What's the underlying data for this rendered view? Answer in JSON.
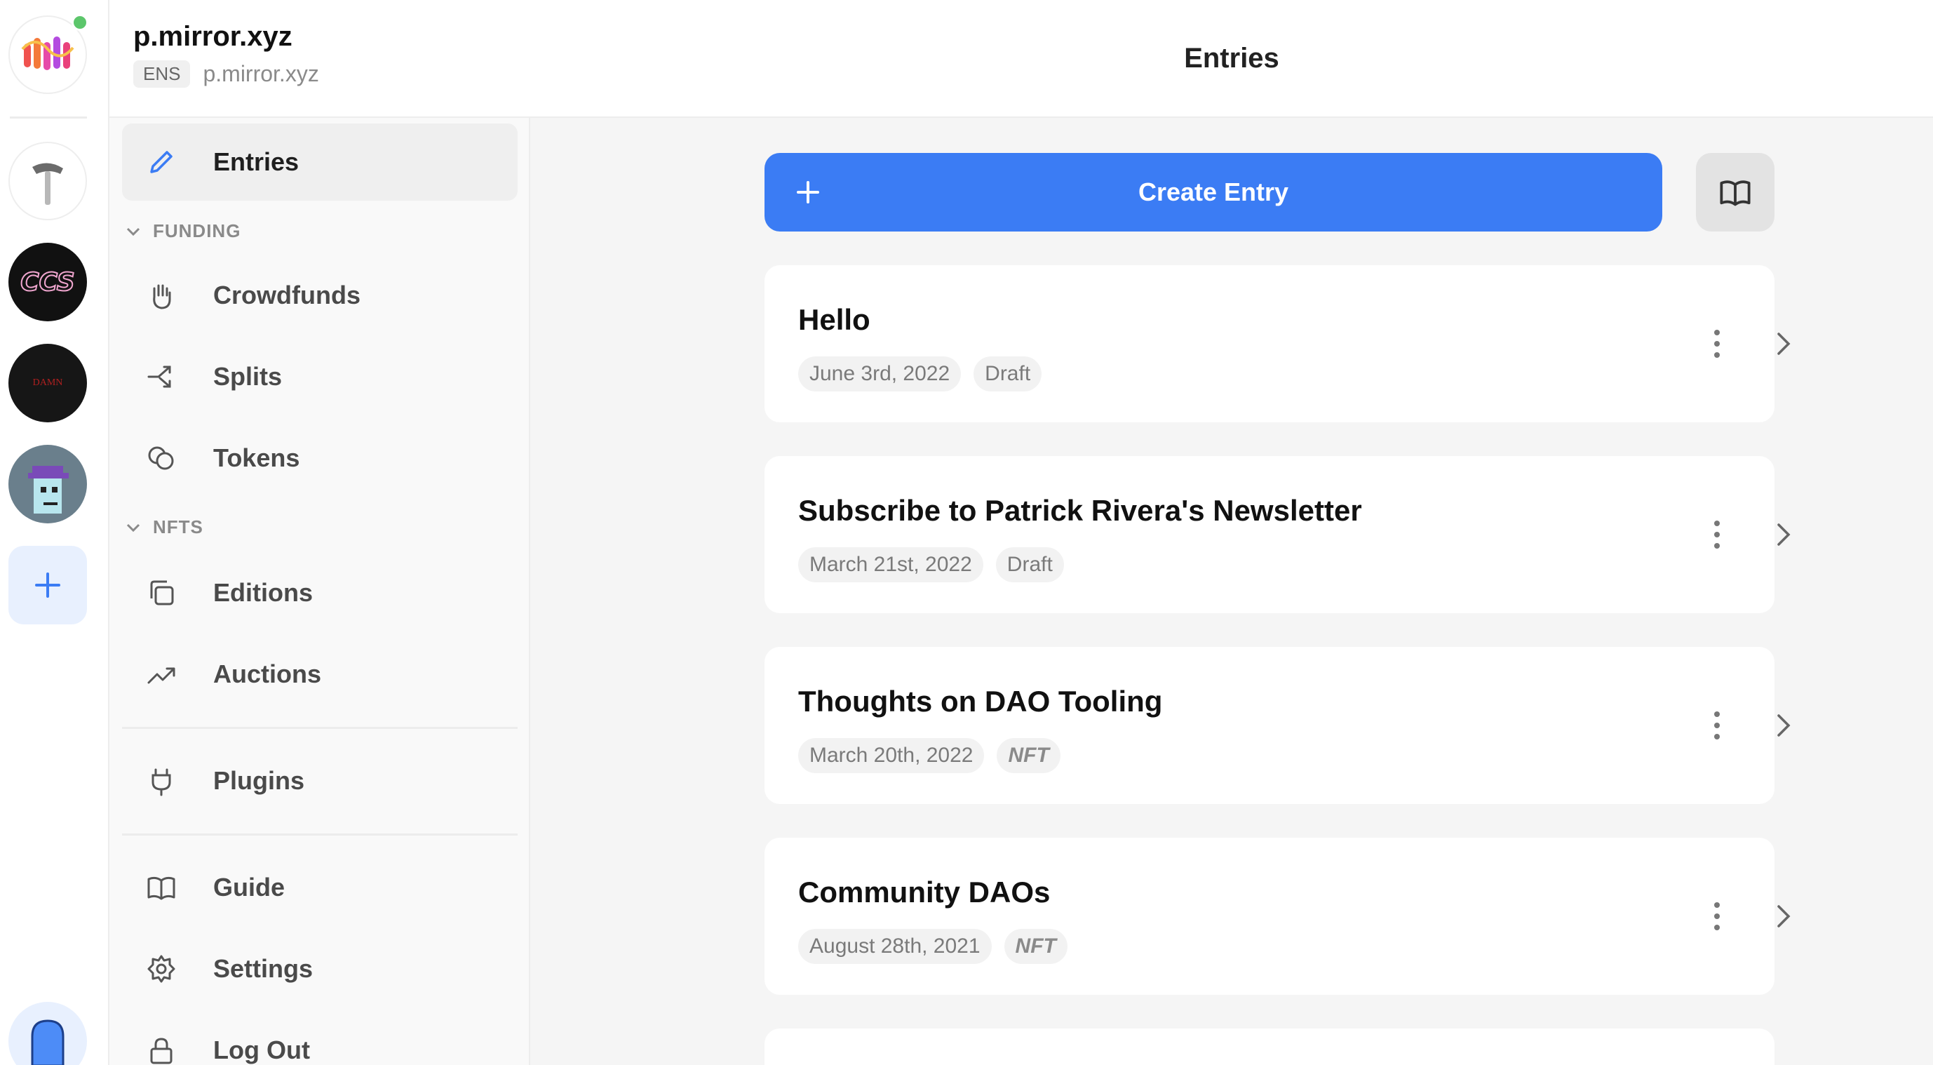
{
  "publication": {
    "name": "p.mirror.xyz",
    "ens_badge": "ENS",
    "ens_domain": "p.mirror.xyz"
  },
  "rail": {
    "avatars": [
      "mirror-logo",
      "hammer-icon",
      "ccs-avatar",
      "damn-avatar",
      "punk-avatar"
    ],
    "damn_text": "DAMN"
  },
  "sidebar": {
    "entries_label": "Entries",
    "funding_section": "FUNDING",
    "crowdfunds_label": "Crowdfunds",
    "splits_label": "Splits",
    "tokens_label": "Tokens",
    "nfts_section": "NFTS",
    "editions_label": "Editions",
    "auctions_label": "Auctions",
    "plugins_label": "Plugins",
    "guide_label": "Guide",
    "settings_label": "Settings",
    "logout_label": "Log Out"
  },
  "main": {
    "title": "Entries",
    "create_label": "Create Entry",
    "entries": [
      {
        "title": "Hello",
        "date": "June 3rd, 2022",
        "tag": "Draft"
      },
      {
        "title": "Subscribe to Patrick Rivera's Newsletter",
        "date": "March 21st, 2022",
        "tag": "Draft"
      },
      {
        "title": "Thoughts on DAO Tooling",
        "date": "March 20th, 2022",
        "tag": "NFT"
      },
      {
        "title": "Community DAOs",
        "date": "August 28th, 2021",
        "tag": "NFT"
      }
    ]
  },
  "colors": {
    "accent": "#3b7cf4",
    "online": "#5cc66b"
  }
}
